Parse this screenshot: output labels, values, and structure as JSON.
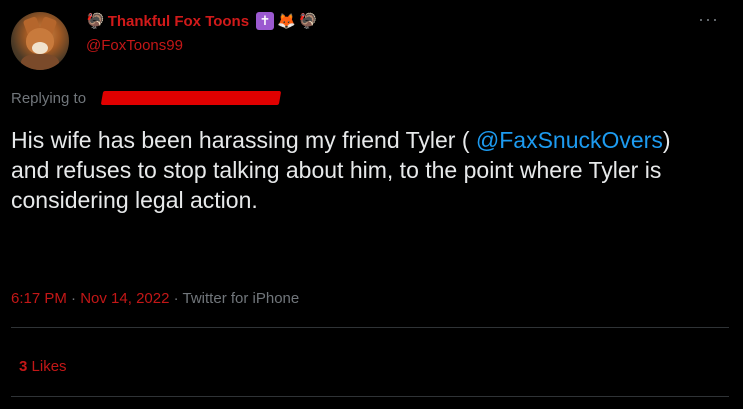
{
  "user": {
    "display_name": "Thankful Fox Toons",
    "handle": "@FoxToons99",
    "name_emojis_before": [
      "turkey"
    ],
    "name_emojis_after": [
      "latin-cross",
      "fox-face",
      "turkey"
    ]
  },
  "reply_context": {
    "label": "Replying to"
  },
  "tweet": {
    "text_before_mention": "His wife has been harassing my friend Tyler ( ",
    "mention": "@FaxSnuckOvers",
    "text_after_mention": ") and refuses to stop talking about him, to the point where Tyler is considering legal action."
  },
  "meta": {
    "time": "6:17 PM",
    "separator1": " · ",
    "date": "Nov 14, 2022",
    "separator2": " · ",
    "source": "Twitter for iPhone"
  },
  "stats": {
    "likes_count": "3",
    "likes_label": "Likes"
  },
  "icons": {
    "more": "more-options-icon"
  },
  "colors": {
    "background": "#000000",
    "name_red": "#d11a1a",
    "handle_red": "#c31717",
    "mention_blue": "#1d9bf0",
    "muted_gray": "#71767b",
    "redaction_red": "#e00000"
  }
}
